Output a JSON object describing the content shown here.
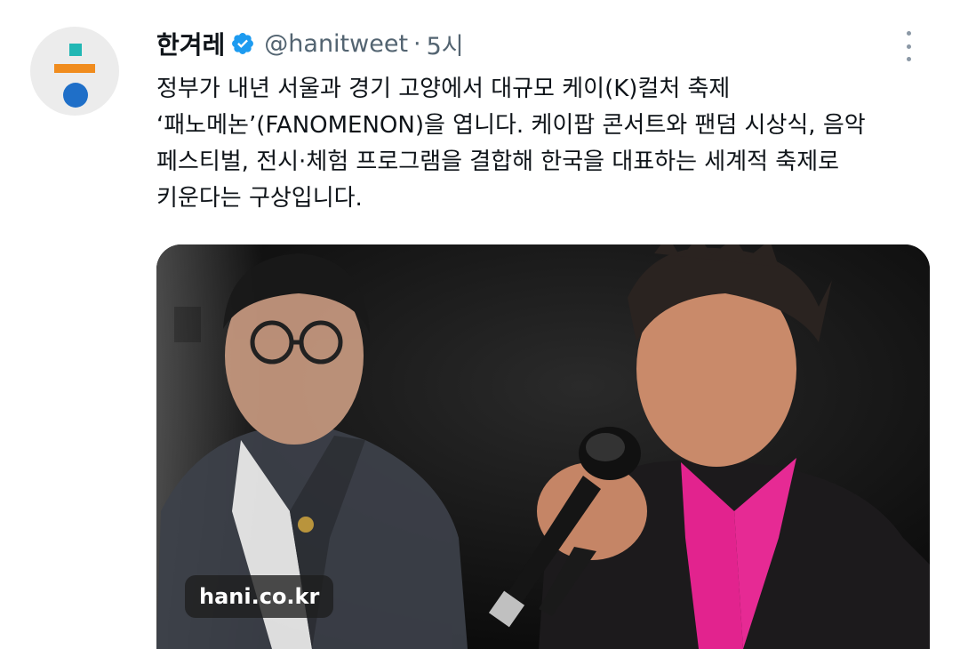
{
  "tweet": {
    "author": "한겨레",
    "handle": "@hanitweet",
    "separator": "·",
    "time": "5시",
    "text": "정부가 내년 서울과 경기 고양에서 대규모 케이(K)컬처 축제\n‘패노메논’(FANOMENON)을 엽니다. 케이팝 콘서트와 팬덤 시상식, 음악\n페스티벌, 전시·체험 프로그램을 결합해 한국을 대표하는 세계적 축제로\n키운다는 구상입니다.",
    "media": {
      "source_badge": "hani.co.kr"
    }
  },
  "icons": {
    "verified": "verified-badge-icon",
    "more": "more-vertical-icon"
  },
  "colors": {
    "verified_blue": "#1d9bf0",
    "secondary_text": "#536471",
    "avatar_teal": "#21b7b4",
    "avatar_orange": "#f08c1e",
    "avatar_blue": "#1f6fc8"
  }
}
